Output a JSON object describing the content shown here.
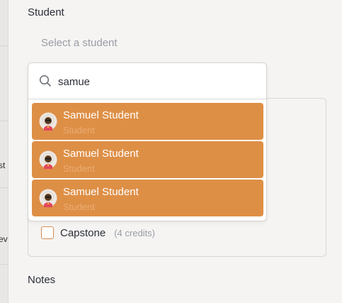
{
  "form": {
    "student_label": "Student",
    "notes_label": "Notes",
    "select_placeholder": "Select a student"
  },
  "left_strip": {
    "fragment_1": "st",
    "fragment_2": "ev"
  },
  "dropdown": {
    "search_value": "samue",
    "options": [
      {
        "name": "Samuel Student",
        "role": "Student"
      },
      {
        "name": "Samuel Student",
        "role": "Student"
      },
      {
        "name": "Samuel Student",
        "role": "Student"
      }
    ]
  },
  "courses": {
    "visible_item": {
      "name": "Capstone",
      "credits": "(4 credits)",
      "checked": false
    }
  },
  "colors": {
    "accent": "#de8f46",
    "checkbox_border": "#d58b4d",
    "text": "#2d2f3a",
    "muted": "#9a9da5"
  },
  "icons": {
    "search": "search-icon",
    "avatar": "avatar-icon"
  }
}
